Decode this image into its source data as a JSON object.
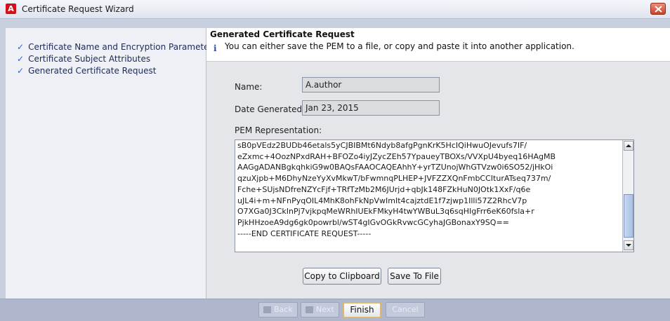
{
  "window": {
    "title": "Certificate Request Wizard"
  },
  "steps": [
    {
      "label": "Certificate Name and Encryption Parameters"
    },
    {
      "label": "Certificate Subject Attributes"
    },
    {
      "label": "Generated Certificate Request"
    }
  ],
  "header": {
    "title": "Generated Certificate Request",
    "message": "You can either save the PEM to a file, or copy and paste it into another application."
  },
  "form": {
    "name_label": "Name:",
    "name_value": "A.author",
    "date_label": "Date Generated:",
    "date_value": "Jan 23, 2015",
    "pem_label": "PEM Representation:",
    "pem_text": "sB0pVEdz2BUDb46etals5yCJBIBMt6Ndyb8afgPgnKrK5HcIQiHwuOJevufs7IF/\neZxmc+4OozNPxdRAH+BFOZo4iyJZycZEh57YpaueyTBOXs/VVXpU4byeq16HAgMB\nAAGgADANBgkqhkiG9w0BAQsFAAOCAQEAhhY+yrTZUnojWhGTVzw0i6SO52/jHkOi\nqzuXjpb+M6DhyNzeYyXvMkwT/bFwmnqPLHEP+JVFZZXQnFmbCCIturATseq737m/\nFche+SUjsNDfreNZYcFjf+TRfTzMb2M6JUrjd+qbJk148FZkHuN0JOtk1XxF/q6e\nuJL4i+m+NFnPyqOIL4MhK8ohFkNpVwImIt4cajztdE1f7zjwp1Illi57Z2RhcV7p\nO7XGa0J3CkInPj7vjkpqMeWRhIUEkFMkyH4twYWBuL3q6sqHIgFrr6eK60fsla+r\nPjkHHzoeA9dg6gk0powrbl/wST4gIGvOGkRvwcGCyhaJGBonaxY9SQ==\n-----END CERTIFICATE REQUEST-----"
  },
  "buttons": {
    "copy": "Copy to Clipboard",
    "save": "Save To File",
    "back": "Back",
    "next": "Next",
    "finish": "Finish",
    "cancel": "Cancel"
  }
}
